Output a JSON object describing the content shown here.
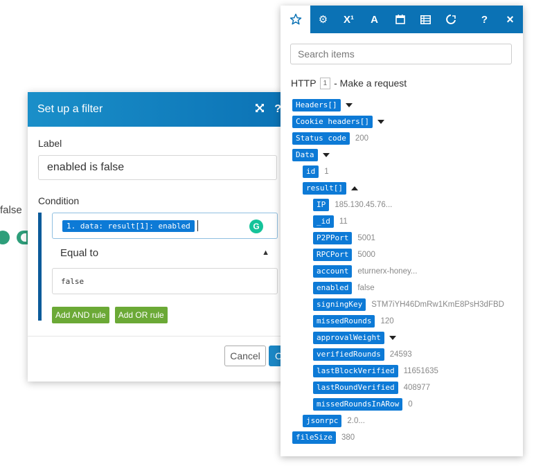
{
  "background": {
    "partial_label": "false"
  },
  "filter": {
    "title": "Set up a filter",
    "label_heading": "Label",
    "label_value": "enabled is false",
    "condition_heading": "Condition",
    "condition_pill": "1. data: result[1]: enabled",
    "operator": "Equal to",
    "value": "false",
    "add_and": "Add AND rule",
    "add_or": "Add OR rule",
    "cancel": "Cancel",
    "ok": "O"
  },
  "mapping": {
    "tabs": [
      "star-icon",
      "gear-icon",
      "superscript-icon",
      "text-icon",
      "calendar-icon",
      "table-icon",
      "tools-icon"
    ],
    "help": "?",
    "close": "×",
    "search_placeholder": "Search items",
    "module": {
      "name": "HTTP",
      "number": "1",
      "action": "- Make a request"
    },
    "items": [
      {
        "key": "Headers[]",
        "value": "",
        "arrow": "down"
      },
      {
        "key": "Cookie headers[]",
        "value": "",
        "arrow": "down"
      },
      {
        "key": "Status code",
        "value": "200",
        "arrow": ""
      },
      {
        "key": "Data",
        "value": "",
        "arrow": "down"
      },
      {
        "key": "id",
        "value": "1",
        "arrow": ""
      },
      {
        "key": "result[]",
        "value": "",
        "arrow": "up"
      },
      {
        "key": "IP",
        "value": "185.130.45.76...",
        "arrow": ""
      },
      {
        "key": "_id",
        "value": "11",
        "arrow": ""
      },
      {
        "key": "P2PPort",
        "value": "5001",
        "arrow": ""
      },
      {
        "key": "RPCPort",
        "value": "5000",
        "arrow": ""
      },
      {
        "key": "account",
        "value": "eturnerx-honey...",
        "arrow": ""
      },
      {
        "key": "enabled",
        "value": "false",
        "arrow": ""
      },
      {
        "key": "signingKey",
        "value": "STM7iYH46DmRw1KmE8PsH3dFBD",
        "arrow": ""
      },
      {
        "key": "missedRounds",
        "value": "120",
        "arrow": ""
      },
      {
        "key": "approvalWeight",
        "value": "",
        "arrow": "down"
      },
      {
        "key": "verifiedRounds",
        "value": "24593",
        "arrow": ""
      },
      {
        "key": "lastBlockVerified",
        "value": "11651635",
        "arrow": ""
      },
      {
        "key": "lastRoundVerified",
        "value": "408977",
        "arrow": ""
      },
      {
        "key": "missedRoundsInARow",
        "value": "0",
        "arrow": ""
      },
      {
        "key": "jsonrpc",
        "value": "2.0...",
        "arrow": ""
      },
      {
        "key": "fileSize",
        "value": "380",
        "arrow": ""
      }
    ]
  }
}
